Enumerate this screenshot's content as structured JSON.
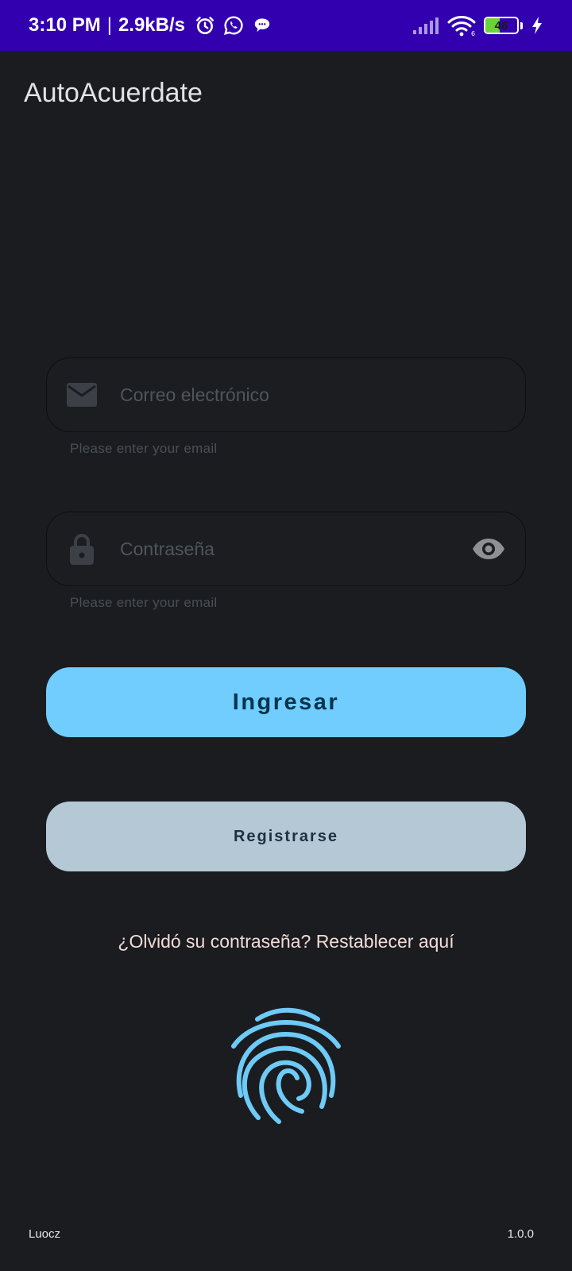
{
  "status_bar": {
    "time": "3:10 PM",
    "separator": "|",
    "net_speed": "2.9kB/s",
    "battery_level": "46",
    "icons": [
      "alarm-icon",
      "whatsapp-icon",
      "chat-icon",
      "signal-icon",
      "wifi-icon",
      "battery-icon",
      "charging-icon"
    ]
  },
  "app_bar": {
    "title": "AutoAcuerdate"
  },
  "form": {
    "email": {
      "value": "",
      "placeholder": "Correo electrónico",
      "helper": "Please enter your email",
      "icon": "mail-icon"
    },
    "password": {
      "value": "",
      "placeholder": "Contraseña",
      "helper": "Please enter your email",
      "icon": "lock-icon",
      "toggle_icon": "eye-icon"
    },
    "login_label": "Ingresar",
    "register_label": "Registrarse",
    "forgot_label": "¿Olvidó su contraseña? Restablecer aquí",
    "biometric_icon": "fingerprint-icon"
  },
  "footer": {
    "author": "Luocz",
    "version": "1.0.0"
  },
  "colors": {
    "status_bar": "#3300b0",
    "background": "#1a1c1f",
    "primary_button": "#70cdfd",
    "secondary_button": "#b4c8d6",
    "fingerprint": "#6ecaf7",
    "link_text": "#f4dbd6"
  }
}
